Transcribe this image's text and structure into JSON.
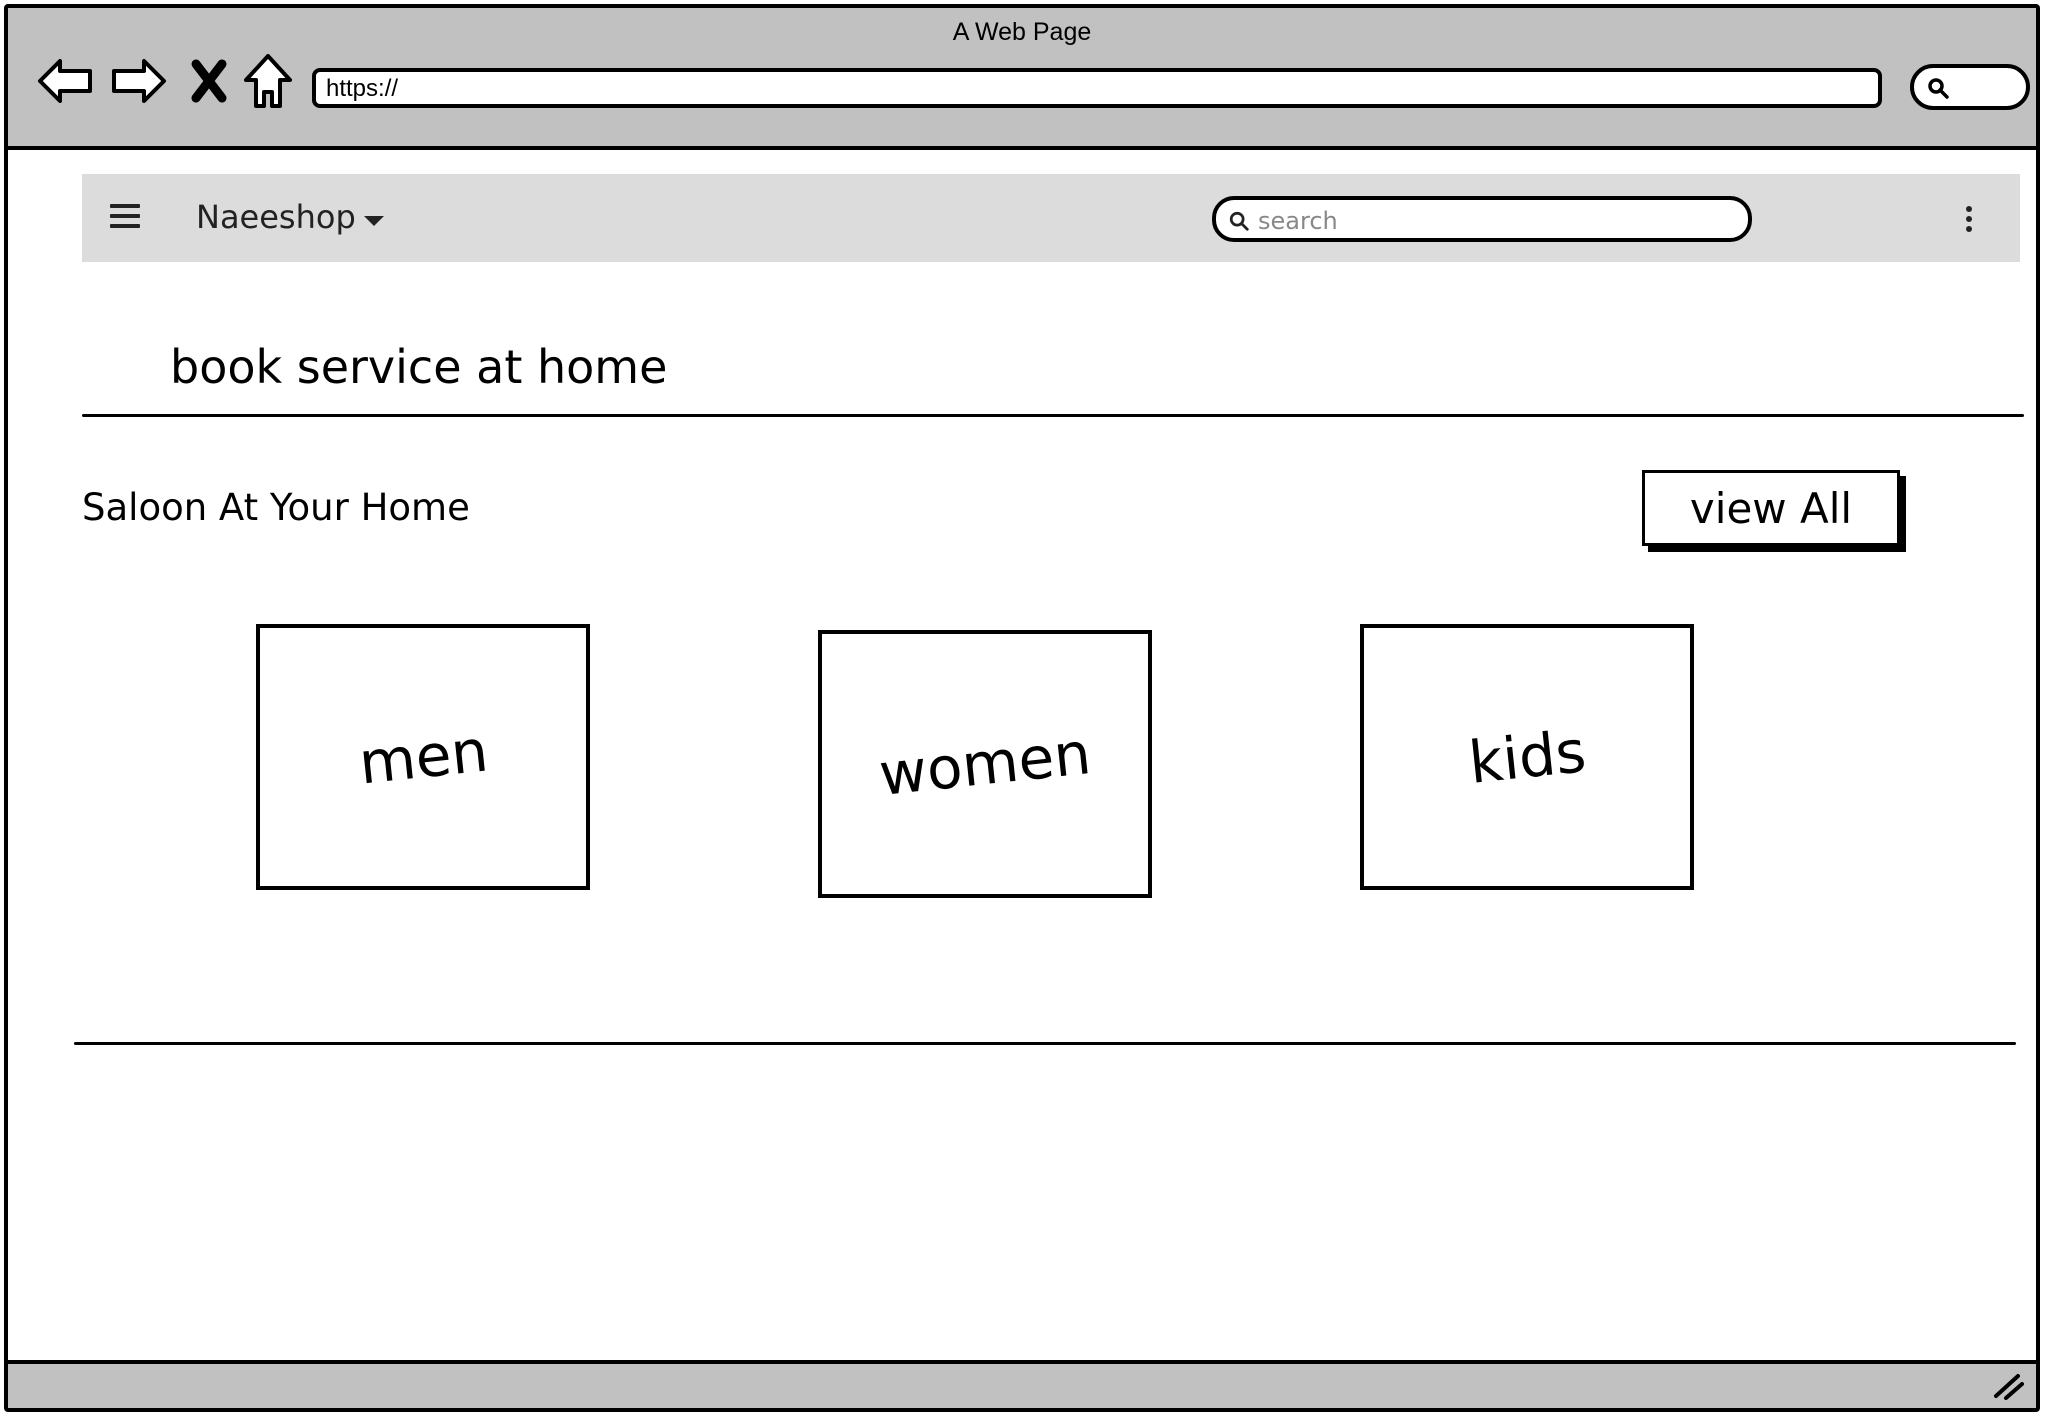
{
  "window": {
    "title": "A Web Page"
  },
  "browser": {
    "url": "https://",
    "icons": [
      "back-arrow-icon",
      "forward-arrow-icon",
      "stop-x-icon",
      "home-icon",
      "search-icon"
    ]
  },
  "app_bar": {
    "brand": "Naeeshop",
    "search_placeholder": "search",
    "icons": [
      "hamburger-menu-icon",
      "caret-down-icon",
      "search-icon",
      "kebab-menu-icon"
    ]
  },
  "main": {
    "heading": "book service at home",
    "section": {
      "title": "Saloon At Your Home",
      "view_all_label": "view All",
      "categories": [
        {
          "label": "men"
        },
        {
          "label": "women"
        },
        {
          "label": "kids"
        }
      ]
    }
  },
  "colors": {
    "chrome": "#c1c1c1",
    "app_bar": "#dcdcdc",
    "ink": "#000000"
  }
}
